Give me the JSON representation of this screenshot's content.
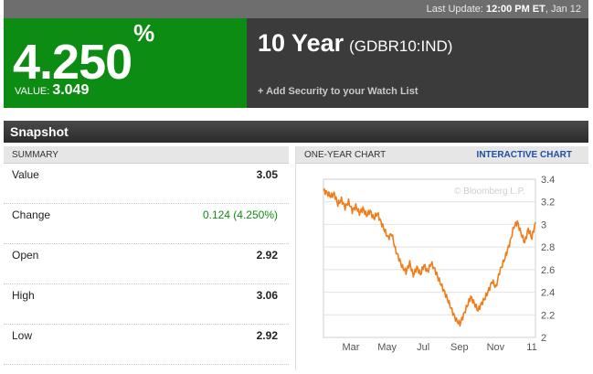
{
  "topbar": {
    "update_label": "Last Update:",
    "update_time": "12:00 PM ET",
    "update_date": ", Jan 12"
  },
  "quote": {
    "value": "4.250",
    "unit": "%",
    "sub_label": "VALUE:",
    "sub_value": "3.049",
    "color": "#0d8c14"
  },
  "security": {
    "title": "10 Year",
    "ticker": "(GDBR10:IND)",
    "watchlist": "+ Add Security to your Watch List"
  },
  "snapshot": {
    "header": "Snapshot"
  },
  "summary": {
    "header": "SUMMARY",
    "rows": [
      {
        "label": "Value",
        "value": "3.05",
        "positive": false
      },
      {
        "label": "Change",
        "value": "0.124 (4.250%)",
        "positive": true
      },
      {
        "label": "Open",
        "value": "2.92",
        "positive": false
      },
      {
        "label": "High",
        "value": "3.06",
        "positive": false
      },
      {
        "label": "Low",
        "value": "2.92",
        "positive": false
      }
    ]
  },
  "chart": {
    "header": "ONE-YEAR CHART",
    "interactive": "INTERACTIVE CHART",
    "watermark": "© Bloomberg L.P.",
    "line_color": "#f07d1a"
  },
  "chart_data": {
    "type": "line",
    "title": "",
    "xlabel": "",
    "ylabel": "",
    "ylim": [
      2.0,
      3.4
    ],
    "yticks": [
      "3.4",
      "3.2",
      "3",
      "2.8",
      "2.6",
      "2.4",
      "2.2",
      "2"
    ],
    "xticks": [
      "Mar",
      "May",
      "Jul",
      "Sep",
      "Nov",
      "11"
    ],
    "grid": true,
    "series": [
      {
        "values": [
          3.3,
          3.28,
          3.25,
          3.27,
          3.18,
          3.22,
          3.15,
          3.2,
          3.12,
          3.16,
          3.1,
          3.14,
          3.08,
          3.12,
          3.05,
          3.1,
          3.02,
          2.95,
          2.88,
          2.92,
          2.78,
          2.7,
          2.62,
          2.58,
          2.66,
          2.55,
          2.62,
          2.56,
          2.64,
          2.58,
          2.66,
          2.6,
          2.52,
          2.45,
          2.38,
          2.3,
          2.22,
          2.15,
          2.12,
          2.2,
          2.28,
          2.36,
          2.3,
          2.24,
          2.3,
          2.35,
          2.42,
          2.5,
          2.44,
          2.58,
          2.66,
          2.75,
          2.85,
          2.98,
          3.02,
          2.92,
          2.84,
          2.96,
          2.88,
          3.02
        ]
      }
    ]
  }
}
